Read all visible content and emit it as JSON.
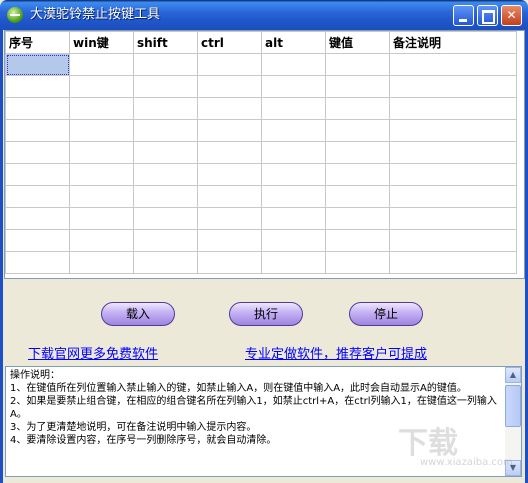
{
  "window": {
    "title": "大漠驼铃禁止按键工具",
    "minimize_icon": "minimize-icon",
    "maximize_icon": "maximize-icon",
    "close_icon": "close-icon",
    "close_glyph": "✕"
  },
  "grid": {
    "columns": [
      "序号",
      "win键",
      "shift",
      "ctrl",
      "alt",
      "键值",
      "备注说明"
    ],
    "rows": [
      [
        "",
        "",
        "",
        "",
        "",
        "",
        ""
      ],
      [
        "",
        "",
        "",
        "",
        "",
        "",
        ""
      ],
      [
        "",
        "",
        "",
        "",
        "",
        "",
        ""
      ],
      [
        "",
        "",
        "",
        "",
        "",
        "",
        ""
      ],
      [
        "",
        "",
        "",
        "",
        "",
        "",
        ""
      ],
      [
        "",
        "",
        "",
        "",
        "",
        "",
        ""
      ],
      [
        "",
        "",
        "",
        "",
        "",
        "",
        ""
      ],
      [
        "",
        "",
        "",
        "",
        "",
        "",
        ""
      ],
      [
        "",
        "",
        "",
        "",
        "",
        "",
        ""
      ],
      [
        "",
        "",
        "",
        "",
        "",
        "",
        ""
      ]
    ],
    "selection_color": "#b4c8ec"
  },
  "buttons": {
    "load": "载入",
    "run": "执行",
    "stop": "停止"
  },
  "links": {
    "download": "下载官网更多免费软件",
    "custom": "专业定做软件，推荐客户可提成"
  },
  "help": {
    "lines": [
      "操作说明：",
      "1、在键值所在列位置输入禁止输入的键，如禁止输入A，则在键值中输入A，此时会自动显示A的键值。",
      "2、如果是要禁止组合键，在相应的组合键名所在列输入1，如禁止ctrl+A，在ctrl列输入1，在键值这一列输入A。",
      "3、为了更清楚地说明，可在备注说明中输入提示内容。",
      "4、要清除设置内容，在序号一列删除序号，就会自动清除。"
    ]
  },
  "scrollbar": {
    "up": "▲",
    "down": "▼"
  },
  "watermark": {
    "main": "下载",
    "sub": "www.xiazaiba.com"
  }
}
